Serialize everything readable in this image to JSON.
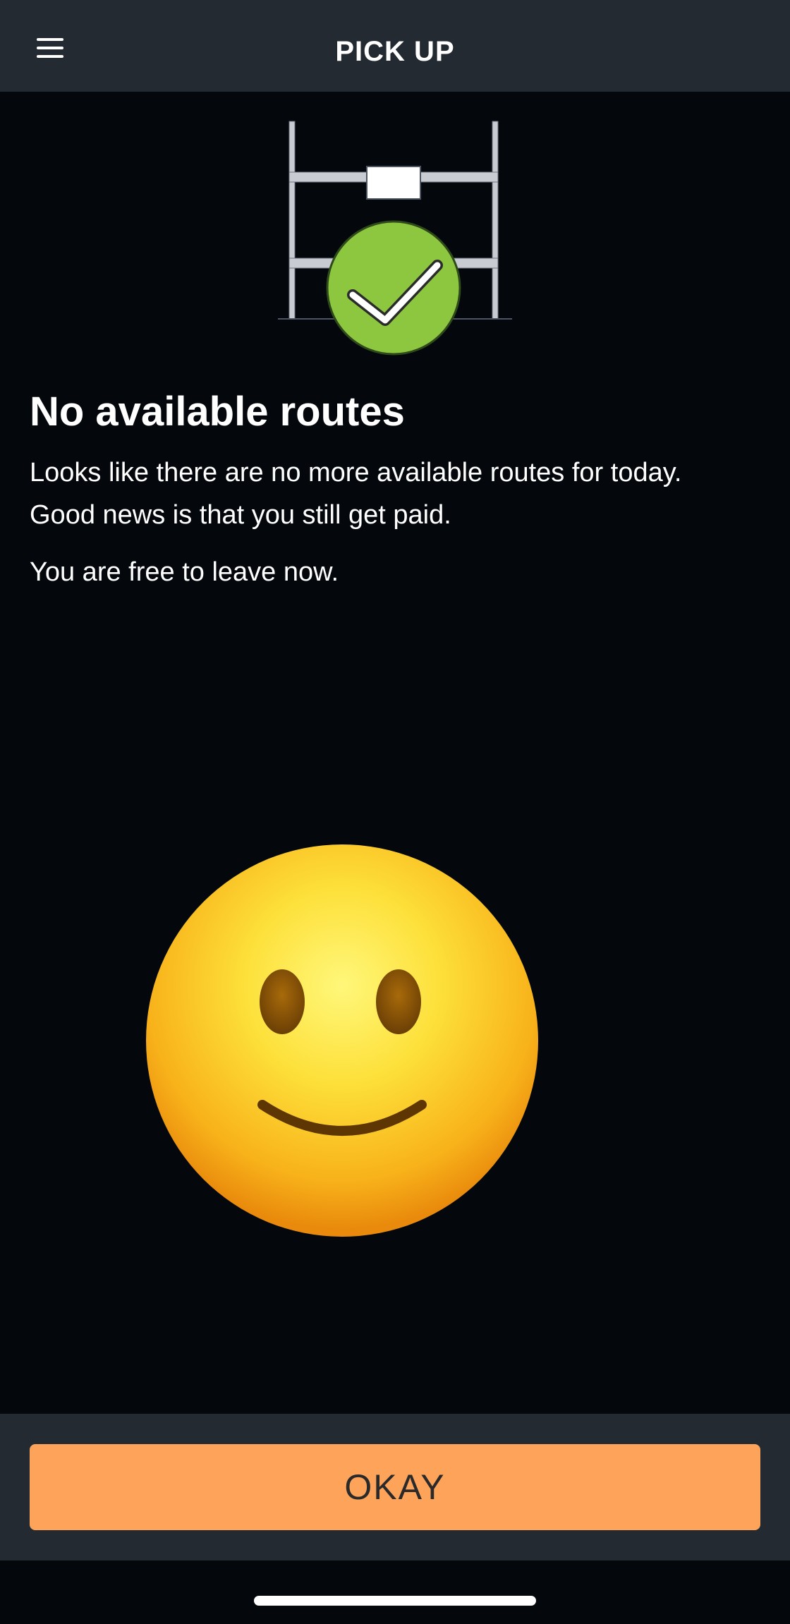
{
  "header": {
    "title": "PICK UP",
    "menu_icon": "hamburger-menu-icon"
  },
  "illustration": {
    "icon": "shelf-with-check-icon",
    "check_color": "#8dc63f"
  },
  "content": {
    "headline": "No available routes",
    "message_line_1": "Looks like there are no more available routes for today.",
    "message_line_2": "Good news is that you still get paid.",
    "message_2": "You are free to leave now.",
    "emoji": "slightly-smiling-face-emoji"
  },
  "footer": {
    "okay_label": "OKAY",
    "button_color": "#fea45a"
  }
}
